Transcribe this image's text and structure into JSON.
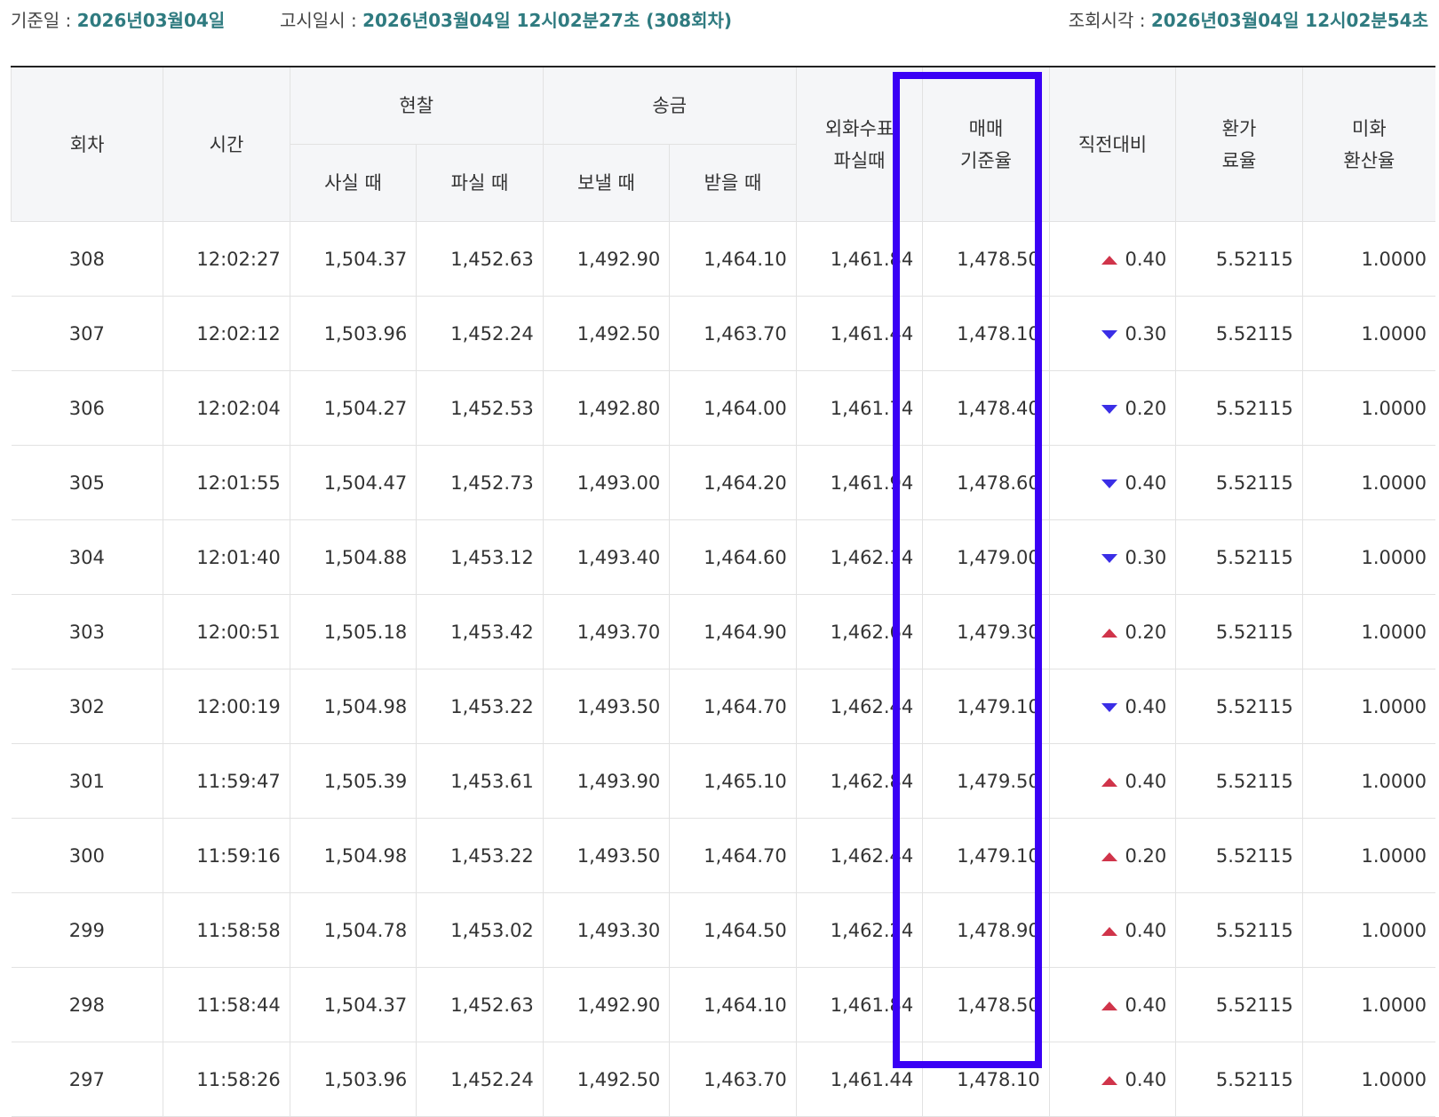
{
  "info": {
    "base_date_label": "기준일 : ",
    "base_date_value": "2026년03월04일",
    "notice_label": "고시일시 : ",
    "notice_value": "2026년03월04일 12시02분27초 (308회차)",
    "inquiry_label": "조회시각 : ",
    "inquiry_value": "2026년03월04일 12시02분54초"
  },
  "headers": {
    "round": "회차",
    "time": "시간",
    "cash": "현찰",
    "cash_buy": "사실 때",
    "cash_sell": "파실 때",
    "remit": "송금",
    "remit_send": "보낼 때",
    "remit_receive": "받을 때",
    "check_line1": "외화수표",
    "check_line2": "파실때",
    "base_line1": "매매",
    "base_line2": "기준율",
    "change": "직전대비",
    "fee_line1": "환가",
    "fee_line2": "료율",
    "usd_line1": "미화",
    "usd_line2": "환산율"
  },
  "colors": {
    "accent_teal": "#2f7b80",
    "up_red": "#d0344a",
    "down_blue": "#3a2ee6",
    "highlight": "#3a00f5"
  },
  "rows": [
    {
      "round": "308",
      "time": "12:02:27",
      "cash_buy": "1,504.37",
      "cash_sell": "1,452.63",
      "send": "1,492.90",
      "receive": "1,464.10",
      "check": "1,461.84",
      "base": "1,478.50",
      "dir": "up",
      "change": "0.40",
      "fee": "5.52115",
      "usd": "1.0000"
    },
    {
      "round": "307",
      "time": "12:02:12",
      "cash_buy": "1,503.96",
      "cash_sell": "1,452.24",
      "send": "1,492.50",
      "receive": "1,463.70",
      "check": "1,461.44",
      "base": "1,478.10",
      "dir": "down",
      "change": "0.30",
      "fee": "5.52115",
      "usd": "1.0000"
    },
    {
      "round": "306",
      "time": "12:02:04",
      "cash_buy": "1,504.27",
      "cash_sell": "1,452.53",
      "send": "1,492.80",
      "receive": "1,464.00",
      "check": "1,461.74",
      "base": "1,478.40",
      "dir": "down",
      "change": "0.20",
      "fee": "5.52115",
      "usd": "1.0000"
    },
    {
      "round": "305",
      "time": "12:01:55",
      "cash_buy": "1,504.47",
      "cash_sell": "1,452.73",
      "send": "1,493.00",
      "receive": "1,464.20",
      "check": "1,461.94",
      "base": "1,478.60",
      "dir": "down",
      "change": "0.40",
      "fee": "5.52115",
      "usd": "1.0000"
    },
    {
      "round": "304",
      "time": "12:01:40",
      "cash_buy": "1,504.88",
      "cash_sell": "1,453.12",
      "send": "1,493.40",
      "receive": "1,464.60",
      "check": "1,462.34",
      "base": "1,479.00",
      "dir": "down",
      "change": "0.30",
      "fee": "5.52115",
      "usd": "1.0000"
    },
    {
      "round": "303",
      "time": "12:00:51",
      "cash_buy": "1,505.18",
      "cash_sell": "1,453.42",
      "send": "1,493.70",
      "receive": "1,464.90",
      "check": "1,462.64",
      "base": "1,479.30",
      "dir": "up",
      "change": "0.20",
      "fee": "5.52115",
      "usd": "1.0000"
    },
    {
      "round": "302",
      "time": "12:00:19",
      "cash_buy": "1,504.98",
      "cash_sell": "1,453.22",
      "send": "1,493.50",
      "receive": "1,464.70",
      "check": "1,462.44",
      "base": "1,479.10",
      "dir": "down",
      "change": "0.40",
      "fee": "5.52115",
      "usd": "1.0000"
    },
    {
      "round": "301",
      "time": "11:59:47",
      "cash_buy": "1,505.39",
      "cash_sell": "1,453.61",
      "send": "1,493.90",
      "receive": "1,465.10",
      "check": "1,462.84",
      "base": "1,479.50",
      "dir": "up",
      "change": "0.40",
      "fee": "5.52115",
      "usd": "1.0000"
    },
    {
      "round": "300",
      "time": "11:59:16",
      "cash_buy": "1,504.98",
      "cash_sell": "1,453.22",
      "send": "1,493.50",
      "receive": "1,464.70",
      "check": "1,462.44",
      "base": "1,479.10",
      "dir": "up",
      "change": "0.20",
      "fee": "5.52115",
      "usd": "1.0000"
    },
    {
      "round": "299",
      "time": "11:58:58",
      "cash_buy": "1,504.78",
      "cash_sell": "1,453.02",
      "send": "1,493.30",
      "receive": "1,464.50",
      "check": "1,462.24",
      "base": "1,478.90",
      "dir": "up",
      "change": "0.40",
      "fee": "5.52115",
      "usd": "1.0000"
    },
    {
      "round": "298",
      "time": "11:58:44",
      "cash_buy": "1,504.37",
      "cash_sell": "1,452.63",
      "send": "1,492.90",
      "receive": "1,464.10",
      "check": "1,461.84",
      "base": "1,478.50",
      "dir": "up",
      "change": "0.40",
      "fee": "5.52115",
      "usd": "1.0000"
    },
    {
      "round": "297",
      "time": "11:58:26",
      "cash_buy": "1,503.96",
      "cash_sell": "1,452.24",
      "send": "1,492.50",
      "receive": "1,463.70",
      "check": "1,461.44",
      "base": "1,478.10",
      "dir": "up",
      "change": "0.40",
      "fee": "5.52115",
      "usd": "1.0000"
    }
  ]
}
